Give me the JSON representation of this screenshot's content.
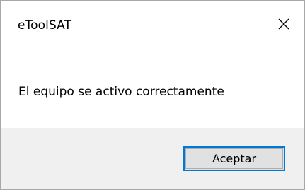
{
  "window": {
    "title": "eToolSAT",
    "close_icon": "close-icon"
  },
  "message": {
    "text": "El equipo se activo correctamente"
  },
  "buttons": {
    "accept_label": "Aceptar"
  },
  "colors": {
    "footer_background": "#f0f0f0",
    "button_focus_border": "#0078d7",
    "button_background": "#e1e1e1"
  }
}
